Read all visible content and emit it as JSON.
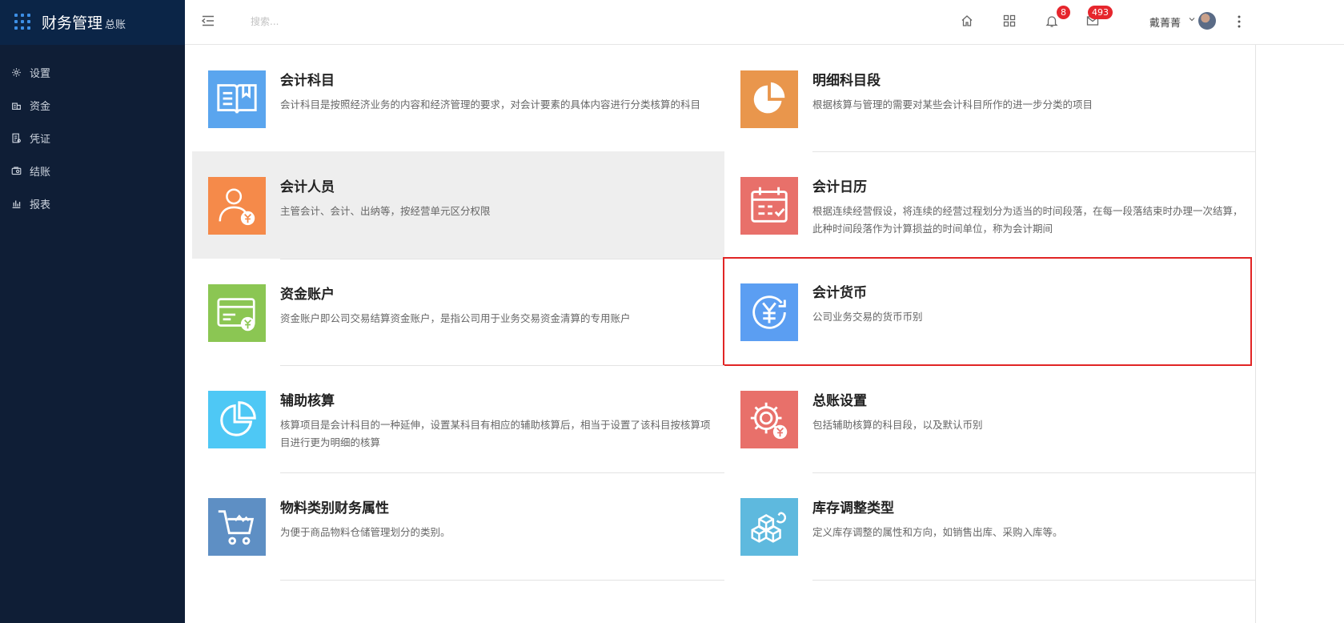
{
  "app": {
    "title": "财务管理",
    "subtitle": "总账"
  },
  "sidebar": {
    "items": [
      {
        "label": "设置",
        "icon": "gear-icon"
      },
      {
        "label": "资金",
        "icon": "funds-icon"
      },
      {
        "label": "凭证",
        "icon": "voucher-icon"
      },
      {
        "label": "结账",
        "icon": "settle-icon"
      },
      {
        "label": "报表",
        "icon": "report-icon"
      }
    ]
  },
  "header": {
    "search_placeholder": "搜索...",
    "notifications_count": "8",
    "messages_count": "493",
    "username": "戴菁菁"
  },
  "cards": [
    {
      "title": "会计科目",
      "desc": "会计科目是按照经济业务的内容和经济管理的要求，对会计要素的具体内容进行分类核算的科目",
      "color": "#5aa5ee",
      "icon": "book-icon"
    },
    {
      "title": "明细科目段",
      "desc": "根据核算与管理的需要对某些会计科目所作的进一步分类的项目",
      "color": "#e9964c",
      "icon": "pie-chart-icon"
    },
    {
      "title": "会计人员",
      "desc": "主管会计、会计、出纳等，按经营单元区分权限",
      "color": "#f58a4a",
      "icon": "accountant-person-icon"
    },
    {
      "title": "会计日历",
      "desc": "根据连续经营假设，将连续的经营过程划分为适当的时间段落，在每一段落结束时办理一次结算，此种时间段落作为计算损益的时间单位，称为会计期间",
      "color": "#e8706a",
      "icon": "calendar-icon"
    },
    {
      "title": "资金账户",
      "desc": "资金账户即公司交易结算资金账户，是指公司用于业务交易资金清算的专用账户",
      "color": "#8bc653",
      "icon": "bank-card-icon"
    },
    {
      "title": "会计货币",
      "desc": "公司业务交易的货币币别",
      "color": "#5b9ef2",
      "icon": "currency-yen-icon"
    },
    {
      "title": "辅助核算",
      "desc": "核算项目是会计科目的一种延伸，设置某科目有相应的辅助核算后，相当于设置了该科目按核算项目进行更为明细的核算",
      "color": "#4ec8f5",
      "icon": "pie-segment-icon"
    },
    {
      "title": "总账设置",
      "desc": "包括辅助核算的科目段，以及默认币别",
      "color": "#e8706a",
      "icon": "settings-yen-icon"
    },
    {
      "title": "物料类别财务属性",
      "desc": "为便于商品物料仓储管理划分的类别。",
      "color": "#5e8fc4",
      "icon": "shopping-cart-icon"
    },
    {
      "title": "库存调整类型",
      "desc": "定义库存调整的属性和方向，如销售出库、采购入库等。",
      "color": "#5eb9de",
      "icon": "inventory-boxes-icon"
    }
  ]
}
